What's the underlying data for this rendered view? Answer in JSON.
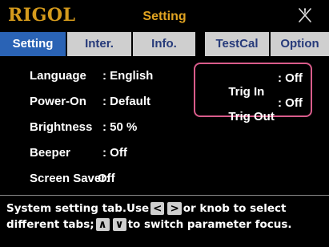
{
  "app": {
    "logo": "RIGOL",
    "title": "Setting",
    "status_icon": "no-signal-icon"
  },
  "tabs": [
    {
      "label": "Setting",
      "active": true
    },
    {
      "label": "Inter.",
      "active": false
    },
    {
      "label": "Info.",
      "active": false
    },
    {
      "label": "TestCal",
      "active": false
    },
    {
      "label": "Option",
      "active": false
    }
  ],
  "settings": [
    {
      "label": "Language",
      "value": ": English"
    },
    {
      "label": "Power-On",
      "value": ": Default"
    },
    {
      "label": "Brightness",
      "value": ": 50 %"
    },
    {
      "label": "Beeper",
      "value": ": Off"
    },
    {
      "label": "Screen Saver:",
      "value": "Off"
    }
  ],
  "trigger": [
    {
      "label": "Trig In",
      "value": ": Off"
    },
    {
      "label": "Trig Out",
      "value": ": Off"
    }
  ],
  "help": {
    "line1_before": "System setting tab.Use",
    "key_left": "<",
    "key_right": ">",
    "line1_after": "or knob to select",
    "line2_before": "different tabs;",
    "key_up": "∧",
    "key_down": "∨",
    "line2_after": "to switch parameter focus."
  },
  "colors": {
    "logo": "#d49a1c",
    "title": "#e0a321",
    "tab_active_bg": "#2a63b5",
    "tab_bg": "#cfcfcf",
    "tab_text": "#263a7a",
    "highlight_border": "#d95c8b"
  }
}
